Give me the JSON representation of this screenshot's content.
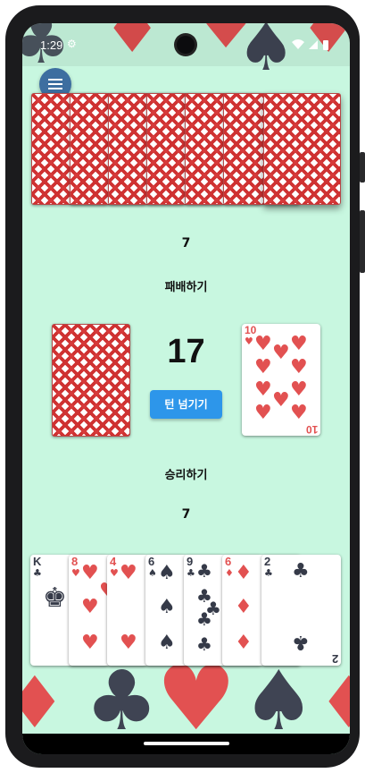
{
  "status_bar": {
    "time": "1:29",
    "icons": [
      "settings-gear-icon",
      "wifi-icon",
      "signal-icon",
      "battery-icon"
    ]
  },
  "menu": {
    "icon": "hamburger-menu-icon"
  },
  "opponent": {
    "card_count": "7",
    "status": "패배하기",
    "hand_backs": 7
  },
  "table": {
    "deck_remaining": "17",
    "turn_button_label": "턴 넘기기",
    "discard_card": {
      "rank": "10",
      "suit": "♥",
      "color": "#e25151"
    }
  },
  "player": {
    "status": "승리하기",
    "card_count": "7",
    "hand": [
      {
        "rank": "K",
        "suit": "♣",
        "color": "#353a48"
      },
      {
        "rank": "8",
        "suit": "♥",
        "color": "#e25151"
      },
      {
        "rank": "4",
        "suit": "♥",
        "color": "#e25151"
      },
      {
        "rank": "6",
        "suit": "♠",
        "color": "#353a48"
      },
      {
        "rank": "9",
        "suit": "♣",
        "color": "#353a48"
      },
      {
        "rank": "6",
        "suit": "♦",
        "color": "#e25151"
      },
      {
        "rank": "2",
        "suit": "♣",
        "color": "#353a48"
      }
    ]
  },
  "colors": {
    "background": "#c8f7e0",
    "button": "#2d96ea",
    "card_back": "#cf3232",
    "red_suit": "#e25151",
    "black_suit": "#353a48"
  }
}
